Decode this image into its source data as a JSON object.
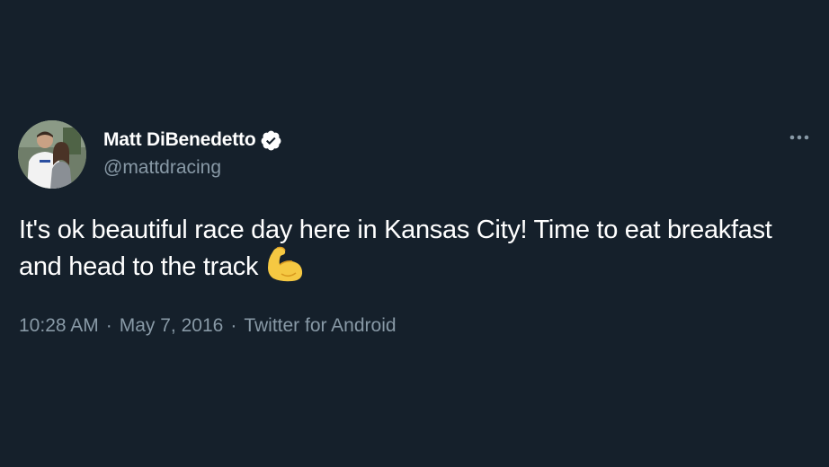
{
  "author": {
    "display_name": "Matt DiBenedetto",
    "handle": "@mattdracing",
    "verified_icon": "verified-badge-icon",
    "avatar_icon": "avatar-photo"
  },
  "tweet": {
    "text": "It's ok beautiful race day here in Kansas City! Time to eat breakfast and head to the track",
    "emoji_icon": "flexed-biceps-emoji"
  },
  "meta": {
    "time": "10:28 AM",
    "separator": "·",
    "date": "May 7, 2016",
    "source": "Twitter for Android"
  },
  "colors": {
    "background": "#15202b",
    "primary_text": "#ffffff",
    "secondary_text": "#8899a6"
  },
  "menu": {
    "icon": "more-options-icon"
  }
}
